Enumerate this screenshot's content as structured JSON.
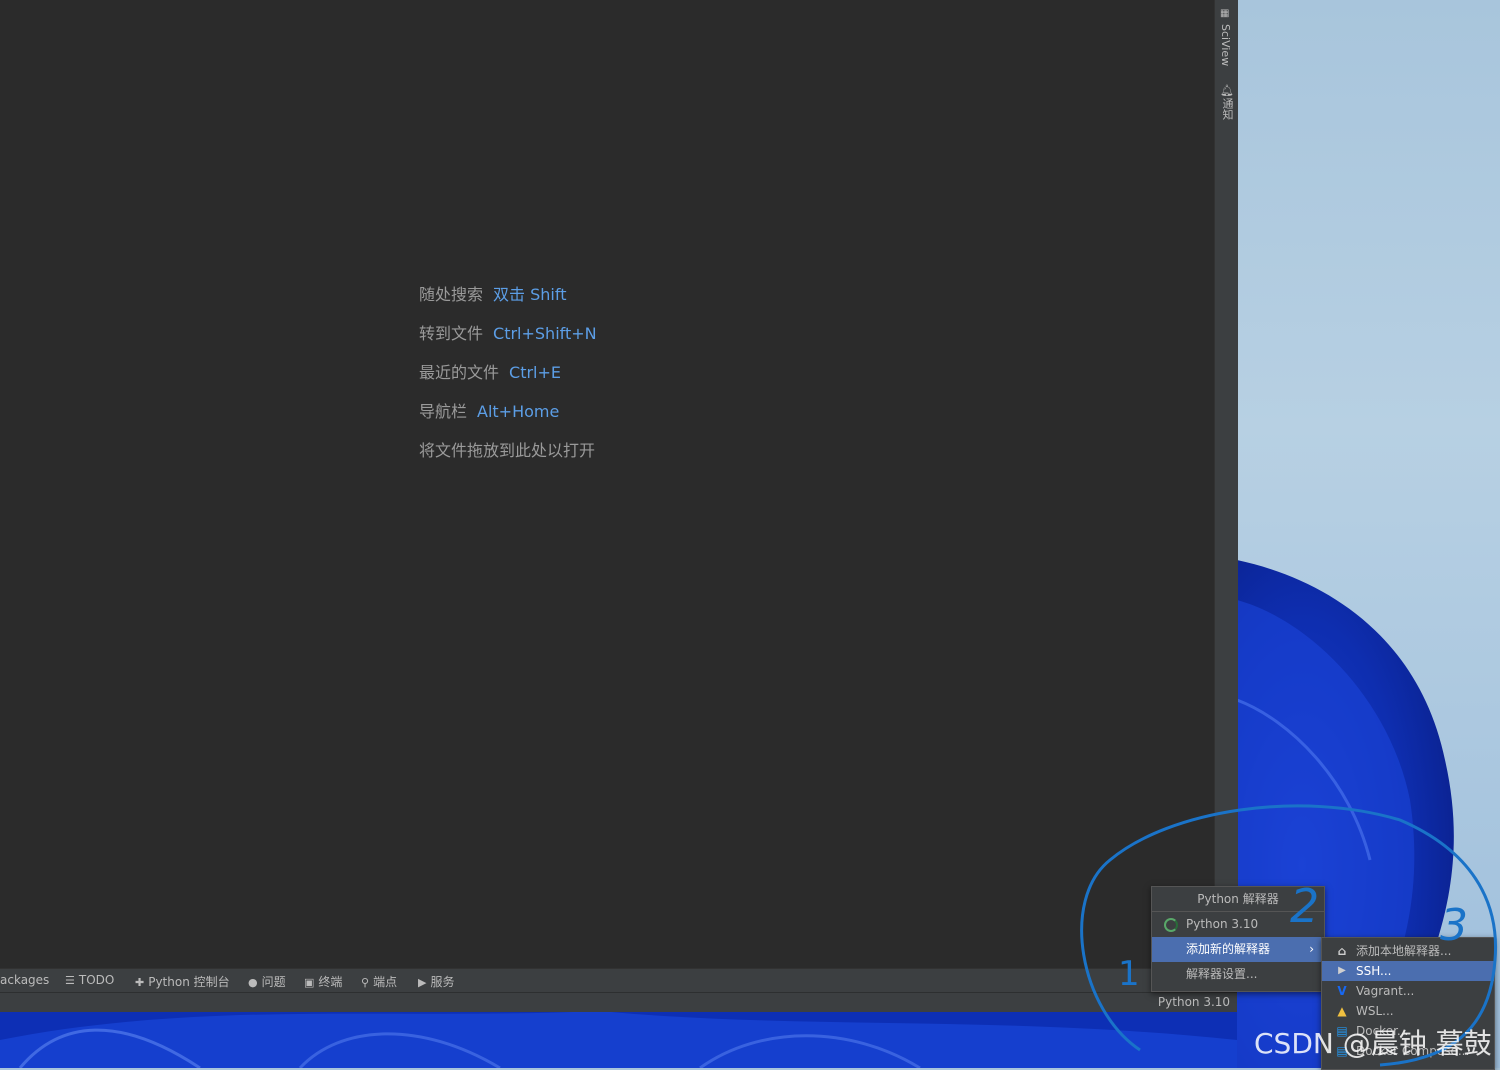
{
  "editor": {
    "hints": [
      {
        "label": "随处搜索",
        "key": "双击 Shift"
      },
      {
        "label": "转到文件",
        "key": "Ctrl+Shift+N"
      },
      {
        "label": "最近的文件",
        "key": "Ctrl+E"
      },
      {
        "label": "导航栏",
        "key": "Alt+Home"
      },
      {
        "label": "将文件拖放到此处以打开",
        "key": ""
      }
    ]
  },
  "right_strip": {
    "sciview": "SciView",
    "notifications": "通知"
  },
  "bottom_tools": [
    {
      "label": "ackages",
      "icon": ""
    },
    {
      "label": "TODO",
      "icon": "list-icon"
    },
    {
      "label": "Python 控制台",
      "icon": "python-icon"
    },
    {
      "label": "问题",
      "icon": "info-icon"
    },
    {
      "label": "终端",
      "icon": "terminal-icon"
    },
    {
      "label": "端点",
      "icon": "endpoints-icon"
    },
    {
      "label": "服务",
      "icon": "play-icon"
    }
  ],
  "status_bar": {
    "interpreter": "Python 3.10"
  },
  "popup": {
    "title": "Python 解释器",
    "items": [
      {
        "label": "Python 3.10"
      },
      {
        "label": "添加新的解释器",
        "selected": true
      },
      {
        "label": "解释器设置..."
      }
    ]
  },
  "submenu": {
    "items": [
      {
        "label": "添加本地解释器...",
        "icon": "home-icon"
      },
      {
        "label": "SSH...",
        "icon": "ssh-icon",
        "selected": true
      },
      {
        "label": "Vagrant...",
        "icon": "vagrant-icon"
      },
      {
        "label": "WSL...",
        "icon": "linux-icon"
      },
      {
        "label": "Docker...",
        "icon": "docker-icon"
      },
      {
        "label": "Docker Compose...",
        "icon": "docker-compose-icon"
      }
    ]
  },
  "annotations": [
    "1",
    "2",
    "3"
  ],
  "watermark": "CSDN @晨钟 暮鼓",
  "colors": {
    "editor_bg": "#2b2b2b",
    "panel_bg": "#3c3f41",
    "accent_key": "#5c9ee6",
    "selection": "#4b6eaf",
    "annotation": "#1a73c8"
  }
}
